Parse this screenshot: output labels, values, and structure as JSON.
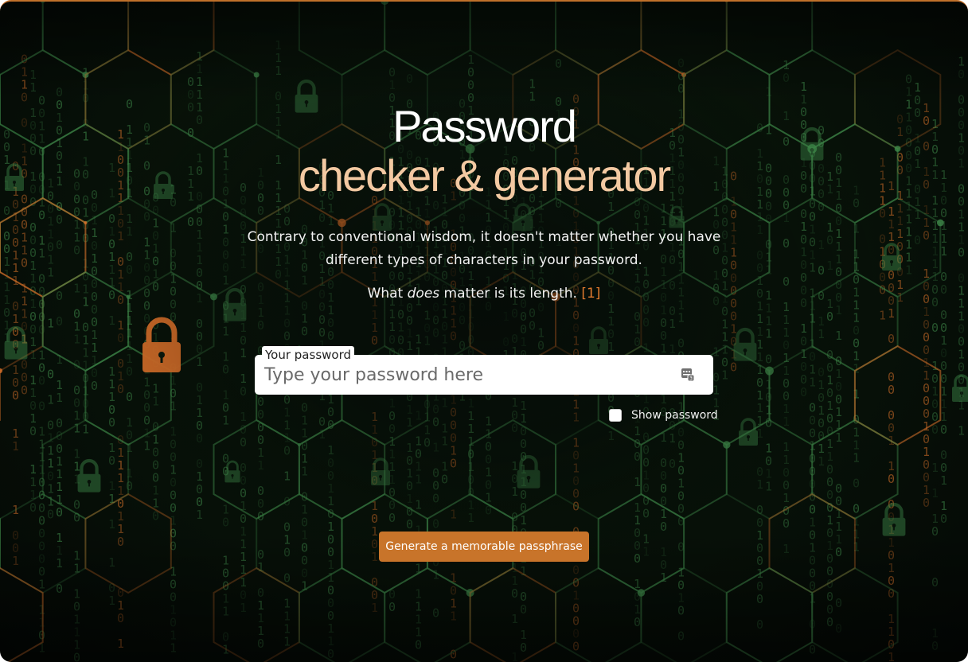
{
  "hero": {
    "title_line1": "Password",
    "title_line2": "checker & generator",
    "intro": "Contrary to conventional wisdom, it doesn't matter whether you have different types of characters in your password.",
    "length_prefix": "What ",
    "length_emphasis": "does",
    "length_suffix": " matter is its length. ",
    "reference_link": "[1]"
  },
  "password_field": {
    "label": "Your password",
    "placeholder": "Type your password here",
    "value": "",
    "icon": "password-manager-icon"
  },
  "show_password": {
    "label": "Show password",
    "checked": false
  },
  "generate_button": {
    "label": "Generate a memorable passphrase"
  },
  "colors": {
    "background": "#081309",
    "title_white": "#ffffff",
    "title_accent": "#f3c9a2",
    "link_orange": "#e07a2e",
    "button_orange": "#c8742a",
    "circuit_green": "#3f8a4a",
    "circuit_orange": "#d9722a"
  }
}
